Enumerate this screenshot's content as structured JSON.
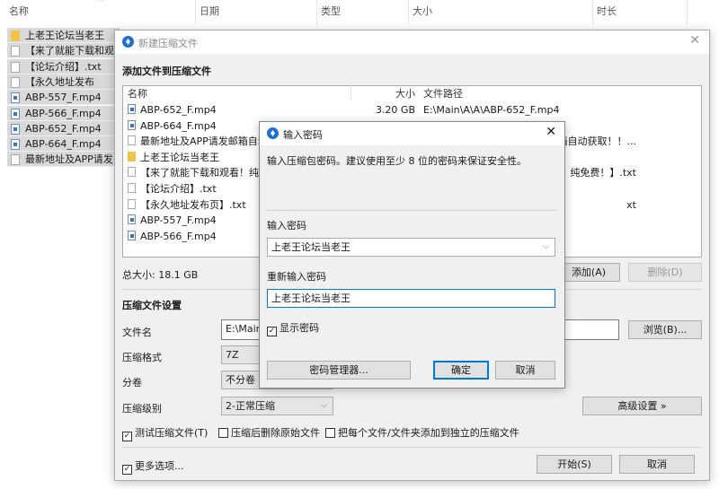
{
  "explorer": {
    "columns": [
      "名称",
      "日期",
      "类型",
      "大小",
      "时长"
    ],
    "files": [
      {
        "name": "上老王论坛当老王",
        "icon": "folder"
      },
      {
        "name": "【来了就能下载和观看",
        "icon": "doc"
      },
      {
        "name": "【论坛介绍】.txt",
        "icon": "doc"
      },
      {
        "name": "【永久地址发布页】.txt",
        "icon": "doc"
      },
      {
        "name": "ABP-557_F.mp4",
        "icon": "video"
      },
      {
        "name": "ABP-566_F.mp4",
        "icon": "video"
      },
      {
        "name": "ABP-652_F.mp4",
        "icon": "video"
      },
      {
        "name": "ABP-664_F.mp4",
        "icon": "video"
      },
      {
        "name": "最新地址及APP请发邮",
        "icon": "doc"
      }
    ]
  },
  "main": {
    "title": "新建压缩文件",
    "section_add": "添加文件到压缩文件",
    "list_headers": {
      "name": "名称",
      "size": "大小",
      "path": "文件路径"
    },
    "rows": [
      {
        "name": "ABP-652_F.mp4",
        "icon": "video",
        "size": "3.20 GB",
        "path": "E:\\Main\\A\\A\\ABP-652_F.mp4"
      },
      {
        "name": "ABP-664_F.mp4",
        "icon": "video",
        "size": "",
        "path": ""
      },
      {
        "name": "最新地址及APP请发邮箱自动获",
        "icon": "doc",
        "size": "",
        "path": "箱自动获取！！..."
      },
      {
        "name": "上老王论坛当老王",
        "icon": "folder",
        "size": "",
        "path": ""
      },
      {
        "name": "【来了就能下载和观看！纯免费",
        "icon": "doc",
        "size": "",
        "path": "！纯免费！】.txt"
      },
      {
        "name": "【论坛介绍】.txt",
        "icon": "doc",
        "size": "",
        "path": ""
      },
      {
        "name": "【永久地址发布页】.txt",
        "icon": "doc",
        "size": "",
        "path": "xt"
      },
      {
        "name": "ABP-557_F.mp4",
        "icon": "video",
        "size": "",
        "path": ""
      },
      {
        "name": "ABP-566_F.mp4",
        "icon": "video",
        "size": "",
        "path": ""
      }
    ],
    "total_size": "总大小: 18.1 GB",
    "add_button": "添加(A)",
    "delete_button": "删除(D)",
    "section_settings": "压缩文件设置",
    "filename_label": "文件名",
    "filename_value": "E:\\Main\\",
    "browse_button": "浏览(B)...",
    "format_label": "压缩格式",
    "format_value": "7Z",
    "volume_label": "分卷",
    "volume_value": "不分卷",
    "level_label": "压缩级别",
    "level_value": "2-正常压缩",
    "advanced_button": "高级设置 »",
    "opt_test": "测试压缩文件(T)",
    "opt_delete": "压缩后删除原始文件",
    "opt_separate": "把每个文件/文件夹添加到独立的压缩文件",
    "more_options": "更多选项...",
    "start_button": "开始(S)",
    "cancel_button": "取消"
  },
  "password": {
    "title": "输入密码",
    "hint": "输入压缩包密码。建议使用至少 8 位的密码来保证安全性。",
    "pw_label": "输入密码",
    "pw_value": "上老王论坛当老王",
    "re_label": "重新输入密码",
    "re_value": "上老王论坛当老王",
    "show_label": "显示密码",
    "manager_button": "密码管理器...",
    "ok_button": "确定",
    "cancel_button": "取消"
  }
}
